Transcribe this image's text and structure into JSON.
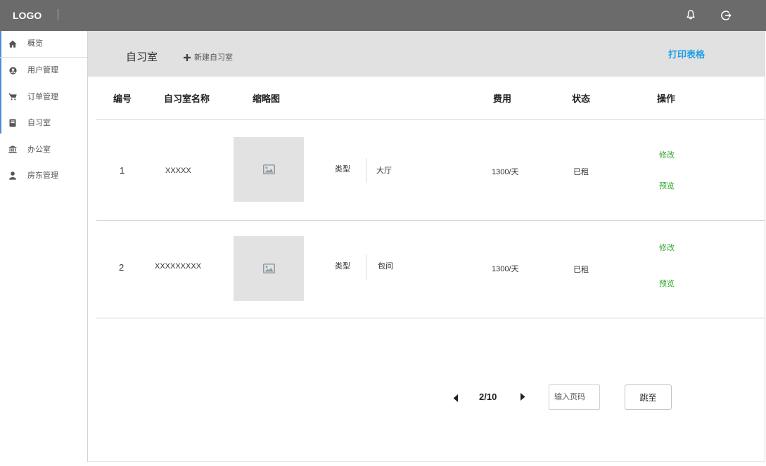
{
  "header": {
    "logo": "LOGO",
    "icons": [
      "bell-icon",
      "logout-icon"
    ]
  },
  "sidebar": {
    "items": [
      {
        "label": "概览",
        "icon": "home-icon"
      },
      {
        "label": "用户管理",
        "icon": "user-circle-icon"
      },
      {
        "label": "订单管理",
        "icon": "cart-icon"
      },
      {
        "label": "自习室",
        "icon": "book-icon"
      },
      {
        "label": "办公室",
        "icon": "bank-icon"
      },
      {
        "label": "房东管理",
        "icon": "user-icon"
      }
    ]
  },
  "toolbar": {
    "title": "自习室",
    "new_icon": "plus-icon",
    "new_label": "新建自习室",
    "print_label": "打印表格"
  },
  "table": {
    "columns": [
      "编号",
      "自习室名称",
      "缩略图",
      "费用",
      "状态",
      "操作"
    ],
    "rows": [
      {
        "id": "1",
        "name": "XXXXX",
        "thumbnail_icon": "image-icon",
        "type_label": "类型",
        "type": "大厅",
        "fee": "1300/天",
        "status": "已租",
        "actions": [
          "修改",
          "预览"
        ]
      },
      {
        "id": "2",
        "name": "XXXXXXXXX",
        "thumbnail_icon": "image-icon",
        "type_label": "类型",
        "type": "包间",
        "fee": "1300/天",
        "status": "已租",
        "actions": [
          "修改",
          "预览"
        ]
      }
    ]
  },
  "pagination": {
    "page_label": "2/10",
    "input_placeholder": "输入页码",
    "jump_label": "跳至"
  },
  "colors": {
    "header_bg": "#6b6b6b",
    "band_bg": "#e1e1e1",
    "accent_blue": "#1e9fe6",
    "action_green": "#2ca52c",
    "sidebar_accent": "#4a8fd6"
  }
}
